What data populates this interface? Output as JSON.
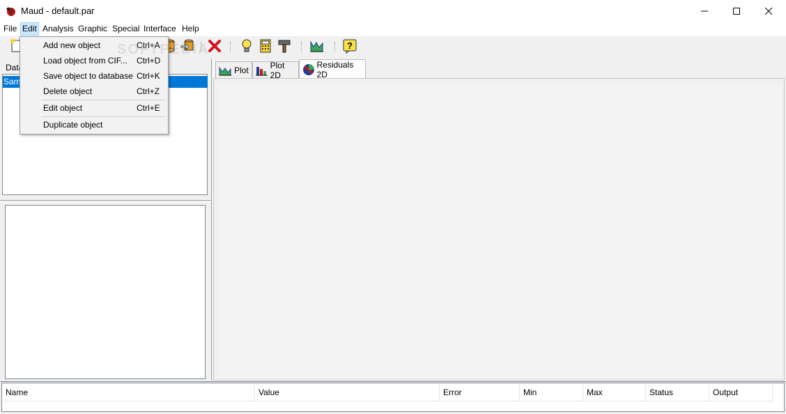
{
  "window": {
    "title": "Maud - default.par"
  },
  "menubar": {
    "items": [
      "File",
      "Edit",
      "Analysis",
      "Graphic",
      "Special",
      "Interface",
      "Help"
    ]
  },
  "edit_menu": {
    "items": [
      {
        "label": "Add new object",
        "shortcut": "Ctrl+A"
      },
      {
        "label": "Load object from CIF...",
        "shortcut": "Ctrl+D"
      },
      {
        "label": "Save object to database",
        "shortcut": "Ctrl+K"
      },
      {
        "label": "Delete object",
        "shortcut": "Ctrl+Z"
      },
      {
        "label": "Edit object",
        "shortcut": "Ctrl+E"
      },
      {
        "label": "Duplicate object",
        "shortcut": ""
      }
    ]
  },
  "left_panel": {
    "header": "Data",
    "selected_item": "Samp"
  },
  "tabs": [
    {
      "label": "Plot",
      "icon": "plot-icon"
    },
    {
      "label": "Plot 2D",
      "icon": "bar-chart-icon"
    },
    {
      "label": "Residuals 2D",
      "icon": "residuals-icon"
    }
  ],
  "table": {
    "columns": [
      "Name",
      "Value",
      "Error",
      "Min",
      "Max",
      "Status",
      "Output"
    ]
  },
  "watermark": "SOFTPEDIA"
}
